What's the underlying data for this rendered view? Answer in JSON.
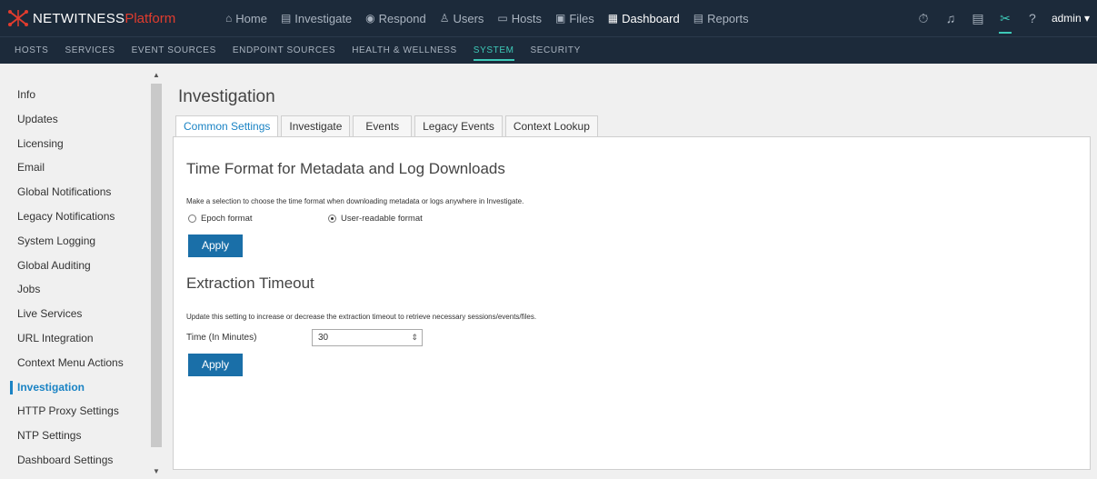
{
  "brand": {
    "name": "NETWITNESS",
    "platform": "Platform"
  },
  "main_nav": [
    {
      "icon": "home-icon",
      "glyph": "⌂",
      "label": "Home"
    },
    {
      "icon": "investigate-icon",
      "glyph": "▤",
      "label": "Investigate"
    },
    {
      "icon": "respond-icon",
      "glyph": "◉",
      "label": "Respond"
    },
    {
      "icon": "users-icon",
      "glyph": "♙",
      "label": "Users"
    },
    {
      "icon": "hosts-icon",
      "glyph": "▭",
      "label": "Hosts"
    },
    {
      "icon": "files-icon",
      "glyph": "▣",
      "label": "Files"
    },
    {
      "icon": "dashboard-icon",
      "glyph": "▦",
      "label": "Dashboard",
      "active": true
    },
    {
      "icon": "reports-icon",
      "glyph": "▤",
      "label": "Reports"
    }
  ],
  "right_nav": {
    "icons": [
      "timer-icon",
      "bell-icon",
      "notes-icon",
      "admin-tools-icon",
      "help-icon"
    ],
    "user": "admin"
  },
  "sub_nav": [
    "HOSTS",
    "SERVICES",
    "EVENT SOURCES",
    "ENDPOINT SOURCES",
    "HEALTH & WELLNESS",
    "SYSTEM",
    "SECURITY"
  ],
  "sub_nav_active": "SYSTEM",
  "sidebar": [
    "Info",
    "Updates",
    "Licensing",
    "Email",
    "Global Notifications",
    "Legacy Notifications",
    "System Logging",
    "Global Auditing",
    "Jobs",
    "Live Services",
    "URL Integration",
    "Context Menu Actions",
    "Investigation",
    "HTTP Proxy Settings",
    "NTP Settings",
    "Dashboard Settings"
  ],
  "sidebar_active": "Investigation",
  "page_title": "Investigation",
  "tabs": [
    "Common Settings",
    "Investigate",
    "Events",
    "Legacy Events",
    "Context Lookup"
  ],
  "tabs_active": "Common Settings",
  "time_format": {
    "title": "Time Format for Metadata and Log Downloads",
    "description": "Make a selection to choose the time format when downloading metadata or logs anywhere in Investigate.",
    "option_epoch": "Epoch format",
    "option_readable": "User-readable format",
    "selected": "User-readable format",
    "apply": "Apply"
  },
  "extraction": {
    "title": "Extraction Timeout",
    "description": "Update this setting to increase or decrease the extraction timeout to retrieve necessary sessions/events/files.",
    "field_label": "Time (In Minutes)",
    "value": "30",
    "apply": "Apply"
  },
  "colors": {
    "topbar": "#1c2a3a",
    "accent": "#3ec9b8",
    "link": "#1a83c4",
    "button": "#1a6fa8",
    "brand_red": "#e23c2e"
  }
}
